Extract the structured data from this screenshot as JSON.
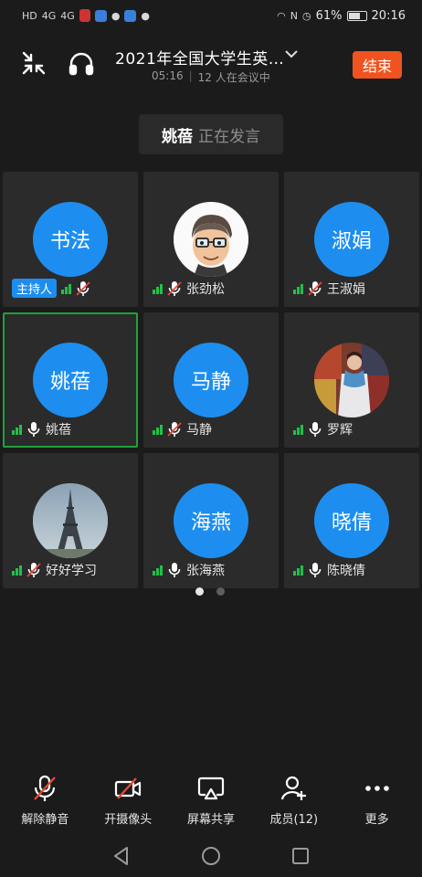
{
  "status_bar": {
    "network_left": "HD",
    "signal_1": "4G",
    "signal_2": "4G",
    "battery_percent": "61%",
    "time": "20:16"
  },
  "header": {
    "title": "2021年全国大学生英…",
    "duration": "05:16",
    "participants_text": "12 人在会议中",
    "end_label": "结束"
  },
  "speaking": {
    "name": "姚蓓",
    "text": "正在发言"
  },
  "participants": [
    {
      "avatar_text": "书法",
      "name": "",
      "host_label": "主持人",
      "muted": true,
      "avatar_type": "text"
    },
    {
      "avatar_text": "",
      "name": "张劲松",
      "muted": true,
      "avatar_type": "memoji"
    },
    {
      "avatar_text": "淑娟",
      "name": "王淑娟",
      "muted": true,
      "avatar_type": "text"
    },
    {
      "avatar_text": "姚蓓",
      "name": "姚蓓",
      "muted": false,
      "avatar_type": "text",
      "active": true
    },
    {
      "avatar_text": "马静",
      "name": "马静",
      "muted": true,
      "avatar_type": "text"
    },
    {
      "avatar_text": "",
      "name": "罗辉",
      "muted": false,
      "avatar_type": "photo-portrait"
    },
    {
      "avatar_text": "",
      "name": "好好学习",
      "muted": true,
      "avatar_type": "photo-eiffel"
    },
    {
      "avatar_text": "海燕",
      "name": "张海燕",
      "muted": false,
      "avatar_type": "text"
    },
    {
      "avatar_text": "晓倩",
      "name": "陈晓倩",
      "muted": false,
      "avatar_type": "text"
    }
  ],
  "pagination": {
    "current": 1,
    "total": 2
  },
  "toolbar": {
    "unmute_label": "解除静音",
    "camera_label": "开摄像头",
    "share_label": "屏幕共享",
    "members_label": "成员(12)",
    "more_label": "更多"
  },
  "colors": {
    "accent_blue": "#1d8ef0",
    "end_orange": "#f0531f",
    "active_green": "#1fa23a",
    "signal_green": "#22c04a",
    "mute_red": "#e5483a"
  }
}
